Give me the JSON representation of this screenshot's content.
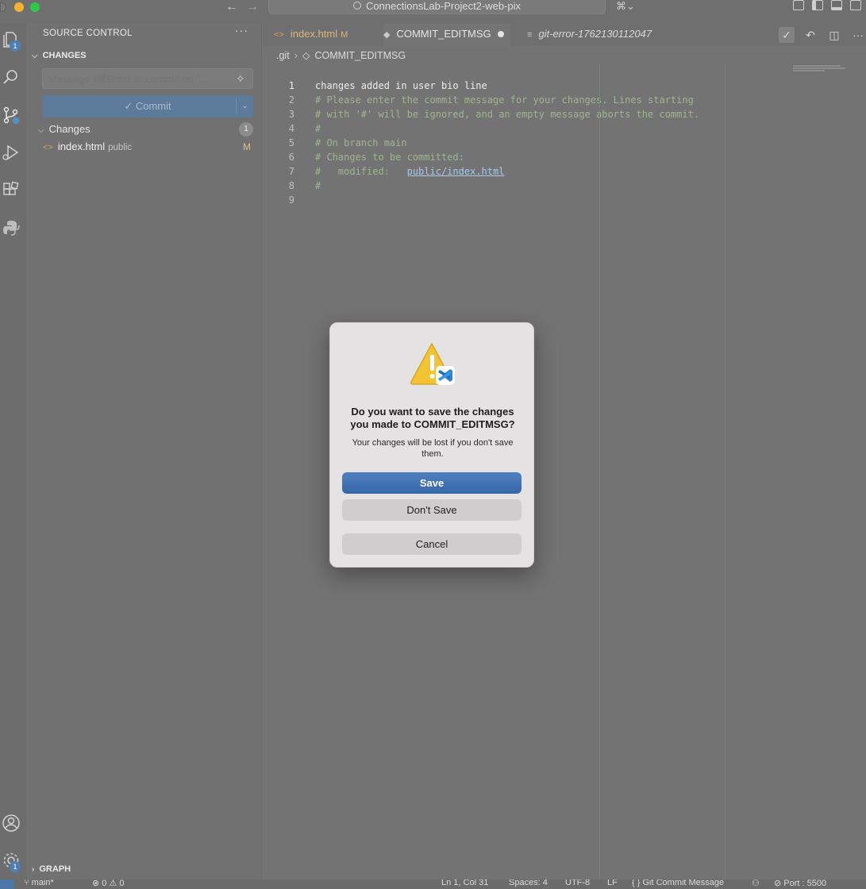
{
  "window": {
    "title": "ConnectionsLab-Project2-web-pix"
  },
  "activity_bar": {
    "explorer_badge": "1",
    "settings_badge": "1"
  },
  "sidebar": {
    "title": "SOURCE CONTROL",
    "more": "···",
    "changes_section": "CHANGES",
    "message_placeholder": "Message (⌘Enter to commit on \"...",
    "commit_label": "✓ Commit",
    "changes_group_label": "Changes",
    "changes_count": "1",
    "files": [
      {
        "name": "index.html",
        "dir": "public",
        "status": "M"
      }
    ],
    "graph_section": "GRAPH"
  },
  "tabs": [
    {
      "label": "index.html",
      "modifier": "M"
    },
    {
      "label": "COMMIT_EDITMSG"
    },
    {
      "label": "git-error-1762130112047"
    }
  ],
  "breadcrumb": {
    "folder": ".git",
    "file": "COMMIT_EDITMSG"
  },
  "editor": {
    "lines": [
      {
        "n": "1",
        "text": "changes added in user bio line"
      },
      {
        "n": "2",
        "text": "# Please enter the commit message for your changes. Lines starting"
      },
      {
        "n": "3",
        "text": "# with '#' will be ignored, and an empty message aborts the commit."
      },
      {
        "n": "4",
        "text": "#"
      },
      {
        "n": "5",
        "text": "# On branch main"
      },
      {
        "n": "6",
        "text": "# Changes to be committed:"
      },
      {
        "n": "7",
        "prefix": "#\tmodified:   ",
        "link": "public/index.html"
      },
      {
        "n": "8",
        "text": "#"
      },
      {
        "n": "9",
        "text": ""
      }
    ]
  },
  "statusbar": {
    "branch": "main*",
    "problems": "⊗ 0 ⚠ 0",
    "position": "Ln 1, Col 31",
    "spaces": "Spaces: 4",
    "encoding": "UTF-8",
    "eol": "LF",
    "language": "{ } Git Commit Message",
    "port": "⊘ Port : 5500"
  },
  "dialog": {
    "title": "Do you want to save the changes you made to COMMIT_EDITMSG?",
    "subtitle": "Your changes will be lost if you don't save them.",
    "save": "Save",
    "dont_save": "Don't Save",
    "cancel": "Cancel"
  },
  "colors": {
    "accent": "#3c6fb0",
    "modified": "#dcb683",
    "comment": "#9fb58f"
  }
}
